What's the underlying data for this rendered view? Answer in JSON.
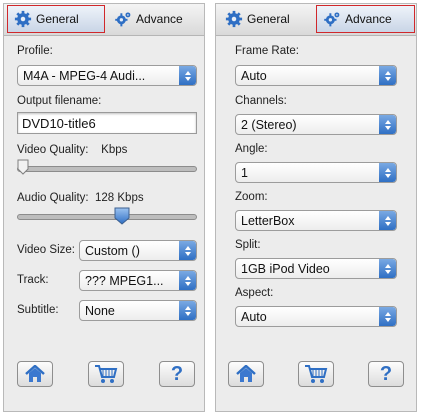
{
  "left": {
    "tabs": [
      {
        "label": "General",
        "icon": "gear-icon"
      },
      {
        "label": "Advance",
        "icon": "gear-plus-icon"
      }
    ],
    "profile": {
      "label": "Profile:",
      "value": "M4A - MPEG-4 Audi..."
    },
    "output_filename": {
      "label": "Output filename:",
      "value": "DVD10-title6"
    },
    "video_quality": {
      "label": "Video Quality:",
      "unit": "Kbps",
      "level": 0.0
    },
    "audio_quality": {
      "label": "Audio Quality:",
      "value": "128 Kbps",
      "level": 0.6
    },
    "video_size": {
      "label": "Video Size:",
      "value": "Custom ()"
    },
    "track": {
      "label": "Track:",
      "value": "??? MPEG1..."
    },
    "subtitle": {
      "label": "Subtitle:",
      "value": "None"
    },
    "buttons": [
      {
        "name": "home-button",
        "icon": "home-icon"
      },
      {
        "name": "cart-button",
        "icon": "cart-icon"
      },
      {
        "name": "help-button",
        "icon": "question-icon",
        "glyph": "?"
      }
    ]
  },
  "right": {
    "tabs": [
      {
        "label": "General",
        "icon": "gear-icon"
      },
      {
        "label": "Advance",
        "icon": "gear-plus-icon"
      }
    ],
    "frame_rate": {
      "label": "Frame Rate:",
      "value": "Auto"
    },
    "channels": {
      "label": "Channels:",
      "value": "2 (Stereo)"
    },
    "angle": {
      "label": "Angle:",
      "value": "1"
    },
    "zoom": {
      "label": "Zoom:",
      "value": "LetterBox"
    },
    "split": {
      "label": "Split:",
      "value": "1GB iPod Video"
    },
    "aspect": {
      "label": "Aspect:",
      "value": "Auto"
    },
    "buttons": [
      {
        "name": "home-button",
        "icon": "home-icon"
      },
      {
        "name": "cart-button",
        "icon": "cart-icon"
      },
      {
        "name": "help-button",
        "icon": "question-icon",
        "glyph": "?"
      }
    ]
  },
  "colors": {
    "accent_blue": "#3b78cf",
    "selection_outline": "#d0282b",
    "panel_bg": "#ececec"
  }
}
